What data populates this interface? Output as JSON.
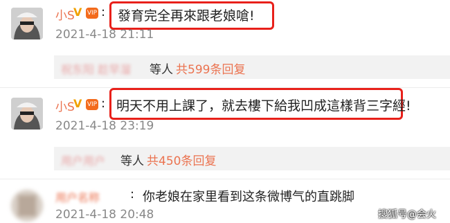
{
  "comments": [
    {
      "username": "小S",
      "v_badge": "V",
      "vip_badge": "VIP",
      "text": "發育完全再來跟老娘嗆!",
      "time": "2021-4-18 21:11"
    },
    {
      "username": "小S",
      "v_badge": "V",
      "vip_badge": "VIP",
      "text": "明天不用上課了，就去樓下給我凹成這樣背三字經!",
      "time": "2021-4-18 23:19"
    },
    {
      "username": "",
      "text": "你老娘在家里看到这条微博气的直跳脚",
      "time": "2021-4-18 20:48"
    }
  ],
  "replies": [
    {
      "names_blurred": "祝东阳 趁早溜",
      "deng": "等人",
      "count": "共599条回复"
    },
    {
      "names_blurred": "用户用户",
      "deng": "等人",
      "count": "共450条回复"
    }
  ],
  "colon": ":",
  "blurred_username": "用户名称",
  "watermark": "搜狐号@会火",
  "colors": {
    "username": "#eb7350",
    "highlight_box": "#e8201a",
    "time": "#888888",
    "reply_bg": "#f2f2f2"
  }
}
